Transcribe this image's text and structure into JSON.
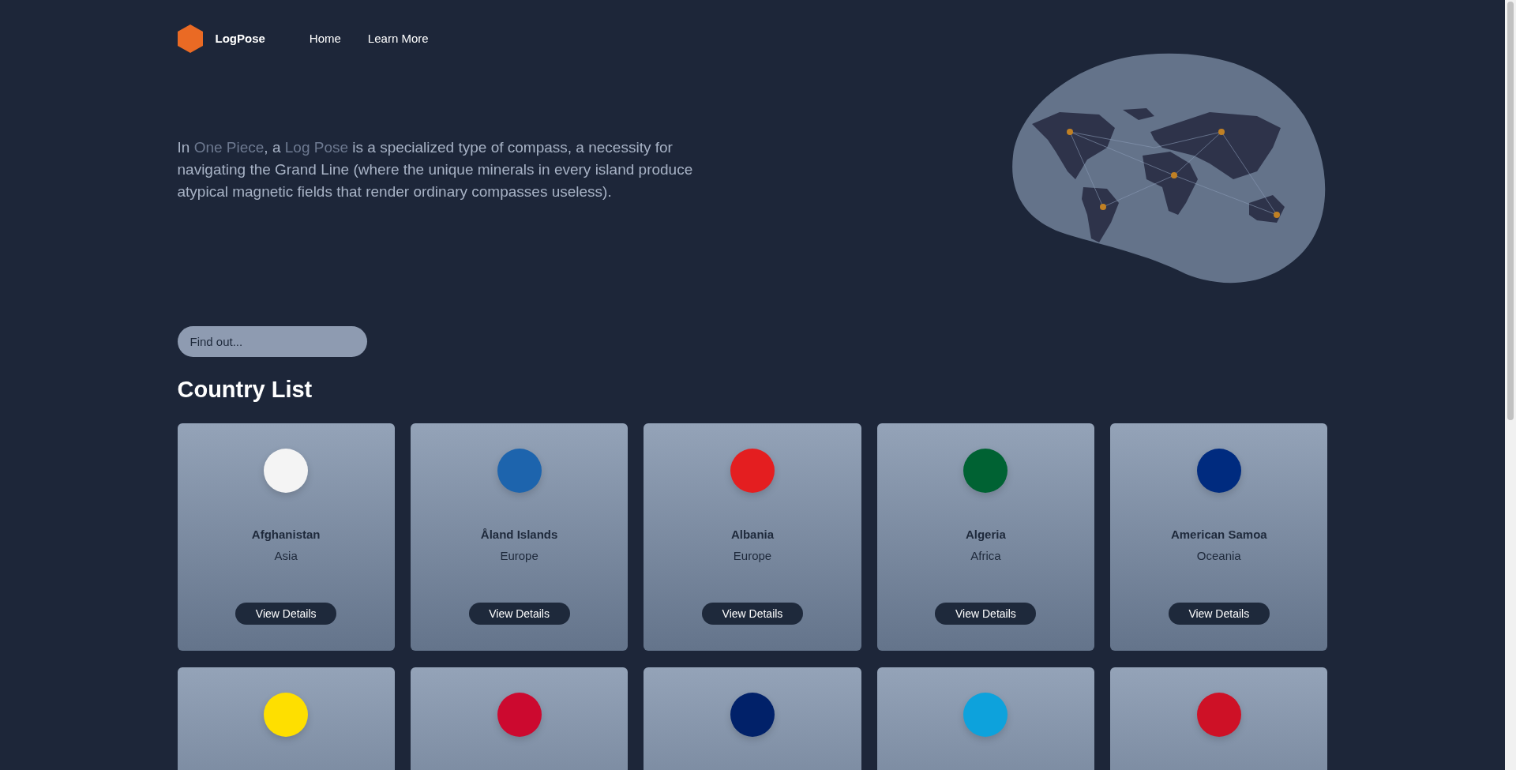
{
  "header": {
    "brand": "LogPose",
    "nav": [
      "Home",
      "Learn More"
    ]
  },
  "hero": {
    "segments": [
      {
        "text": "In ",
        "highlighted": false
      },
      {
        "text": "One Piece",
        "highlighted": true
      },
      {
        "text": ", a ",
        "highlighted": false
      },
      {
        "text": "Log Pose",
        "highlighted": true
      },
      {
        "text": " is a specialized type of compass, a necessity for navigating the Grand Line (where the unique minerals in every island produce atypical magnetic fields that render ordinary compasses useless).",
        "highlighted": false
      }
    ]
  },
  "search": {
    "placeholder": "Find out..."
  },
  "section_title": "Country List",
  "countries": [
    {
      "name": "Afghanistan",
      "region": "Asia",
      "button": "View Details",
      "color": "#f4f4f4"
    },
    {
      "name": "Åland Islands",
      "region": "Europe",
      "button": "View Details",
      "color": "#1d64ad"
    },
    {
      "name": "Albania",
      "region": "Europe",
      "button": "View Details",
      "color": "#e41e20"
    },
    {
      "name": "Algeria",
      "region": "Africa",
      "button": "View Details",
      "color": "#006233"
    },
    {
      "name": "American Samoa",
      "region": "Oceania",
      "button": "View Details",
      "color": "#002b7f"
    },
    {
      "color": "#fedf00"
    },
    {
      "color": "#cc092f"
    },
    {
      "color": "#012169"
    },
    {
      "color": "#0da2dc"
    },
    {
      "color": "#ce1126"
    }
  ]
}
